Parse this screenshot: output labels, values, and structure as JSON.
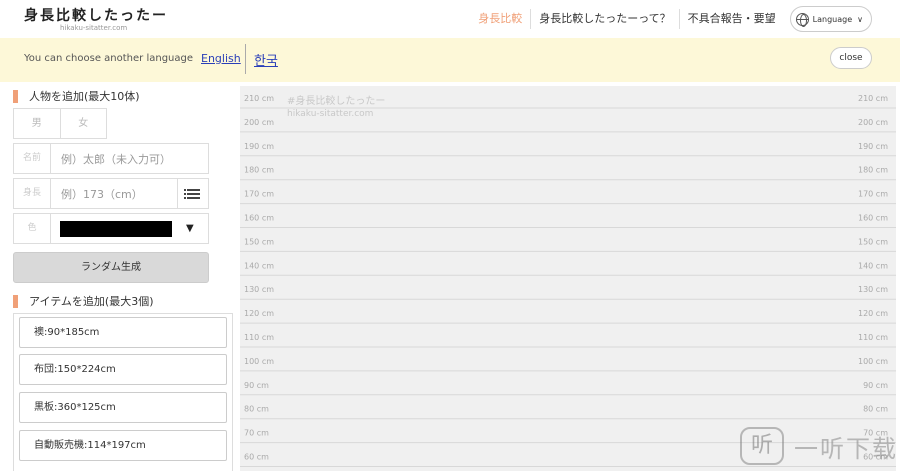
{
  "header": {
    "logo_title": "身長比較したったー",
    "logo_subtitle": "hikaku-sitatter.com",
    "nav": [
      {
        "label": "身長比較",
        "active": true
      },
      {
        "label": "身長比較したったーって？",
        "active": false
      },
      {
        "label": "不具合報告・要望",
        "active": false
      }
    ],
    "language_label": "Language",
    "language_icon": "globe-icon",
    "dropdown_icon": "chevron-down-icon"
  },
  "banner": {
    "message": "You can choose another language",
    "link_english": "English",
    "link_korean": "한국",
    "close_label": "close",
    "background_color": "#fdf8d8"
  },
  "sidebar": {
    "add_person_title": "人物を追加(最大10体)",
    "gender_male": "男",
    "gender_female": "女",
    "name_label": "名前",
    "name_placeholder": "例）太郎（未入力可）",
    "height_label": "身長",
    "height_placeholder": "例）173（cm）",
    "color_label": "色",
    "color_value": "#000000",
    "random_button": "ランダム生成",
    "add_item_title": "アイテムを追加(最大3個)",
    "items": [
      {
        "label": "襖:90*185cm"
      },
      {
        "label": "布団:150*224cm"
      },
      {
        "label": "黒板:360*125cm"
      },
      {
        "label": "自動販売機:114*197cm"
      }
    ],
    "accent_color": "#f0a078"
  },
  "chart": {
    "watermark_title": "#身長比較したったー",
    "watermark_url": "hikaku-sitatter.com",
    "scale_labels": [
      "210 cm",
      "200 cm",
      "190 cm",
      "180 cm",
      "170 cm",
      "160 cm",
      "150 cm",
      "140 cm",
      "130 cm",
      "120 cm",
      "110 cm",
      "100 cm",
      "90 cm",
      "80 cm",
      "70 cm",
      "60 cm"
    ]
  },
  "corner_watermark": {
    "logo_char": "听",
    "text": "一听下载"
  }
}
